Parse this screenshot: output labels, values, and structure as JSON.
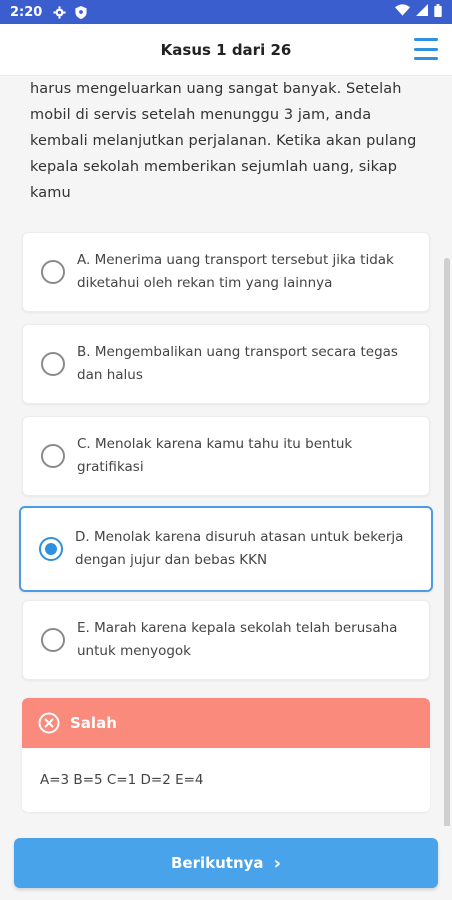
{
  "status_bar": {
    "time": "2:20"
  },
  "header": {
    "title": "Kasus 1 dari 26"
  },
  "question": {
    "text": "harus mengeluarkan uang sangat banyak. Setelah mobil di servis setelah menunggu 3 jam, anda kembali melanjutkan perjalanan. Ketika akan pulang kepala sekolah memberikan sejumlah uang, sikap kamu"
  },
  "options": [
    {
      "label": "A. Menerima uang transport tersebut jika tidak diketahui oleh rekan tim yang lainnya",
      "selected": false
    },
    {
      "label": "B. Mengembalikan uang transport secara tegas dan halus",
      "selected": false
    },
    {
      "label": "C. Menolak karena kamu tahu itu bentuk gratifikasi",
      "selected": false
    },
    {
      "label": "D. Menolak karena disuruh atasan untuk bekerja dengan jujur dan bebas KKN",
      "selected": true
    },
    {
      "label": "E. Marah karena kepala sekolah telah berusaha untuk menyogok",
      "selected": false
    }
  ],
  "result": {
    "status": "Salah",
    "scores": "A=3 B=5 C=1 D=2 E=4"
  },
  "footer": {
    "next_label": "Berikutnya"
  },
  "colors": {
    "status_bar": "#3b5ecf",
    "accent": "#2f8fe0",
    "wrong": "#f98a7c",
    "button": "#49a3ea"
  }
}
